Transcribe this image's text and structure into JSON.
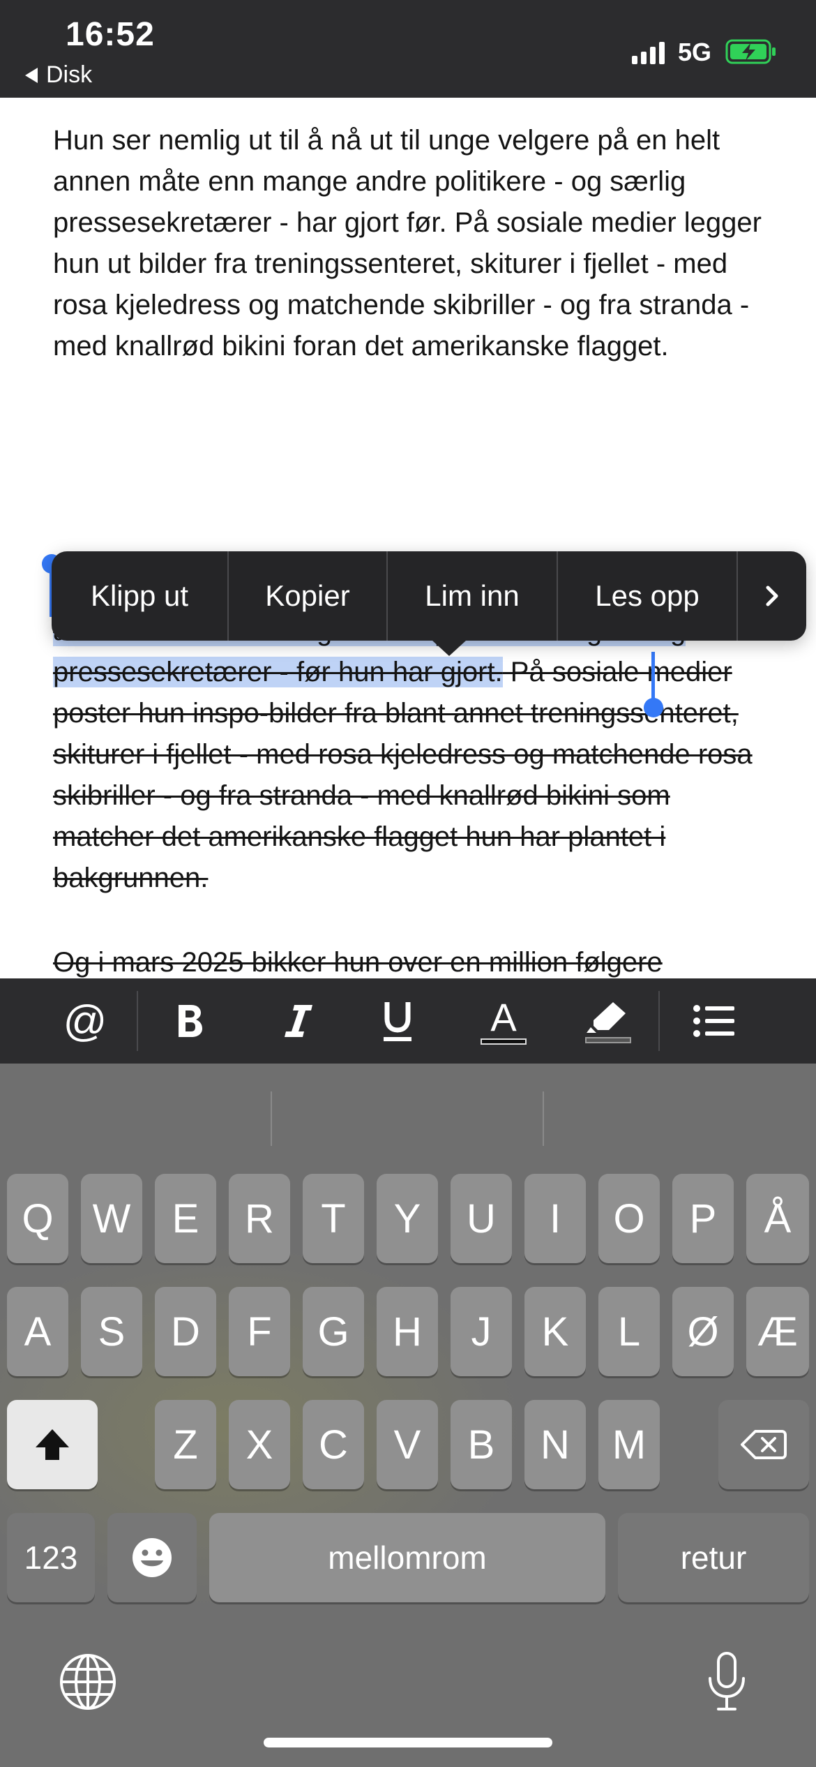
{
  "status_bar": {
    "time": "16:52",
    "back_label": "Disk",
    "network": "5G",
    "battery_state": "charging",
    "battery_color": "#30d158"
  },
  "document": {
    "paragraph_1": "Hun ser nemlig ut til å nå ut til unge velgere på en helt annen måte enn mange andre politikere - og særlig pressesekretærer - har gjort før. På sosiale medier legger hun ut bilder fra treningssenteret, skiturer i fjellet - med rosa kjeledress og matchende skibriller - og fra stranda - med knallrød bikini foran det amerikanske flagget.",
    "paragraph_2_selected": "Hun ser nemlig ut til å nå ut til unge velgere på en helt annen måte enn mange andre politikere - og særlig pressesekretærer - før hun har gjort.",
    "paragraph_2_rest": " På sosiale medier poster hun inspo-bilder fra blant annet treningssenteret, skiturer i fjellet - med rosa kjeledress og matchende rosa skibriller - og fra stranda - med knallrød bikini som matcher det amerikanske flagget hun har plantet i bakgrunnen.",
    "paragraph_3": "Og i mars 2025 bikker hun over en million følgere",
    "selection_color": "#bfd3f6",
    "handle_color": "#3478f6"
  },
  "edit_menu": {
    "items": [
      "Klipp ut",
      "Kopier",
      "Lim inn",
      "Les opp"
    ],
    "more": "›"
  },
  "format_toolbar": {
    "mention": "@",
    "bold_icon": "bold-icon",
    "italic_icon": "italic-icon",
    "underline_icon": "underline-icon",
    "text_color": "A",
    "highlight_icon": "highlighter-icon",
    "list_icon": "bulleted-list-icon"
  },
  "keyboard": {
    "row1": [
      "Q",
      "W",
      "E",
      "R",
      "T",
      "Y",
      "U",
      "I",
      "O",
      "P",
      "Å"
    ],
    "row2": [
      "A",
      "S",
      "D",
      "F",
      "G",
      "H",
      "J",
      "K",
      "L",
      "Ø",
      "Æ"
    ],
    "row3": [
      "Z",
      "X",
      "C",
      "V",
      "B",
      "N",
      "M"
    ],
    "numbers_key": "123",
    "space_key": "mellomrom",
    "return_key": "retur",
    "shift_icon": "shift-icon",
    "delete_icon": "delete-icon",
    "emoji_icon": "emoji-icon",
    "globe_icon": "globe-icon",
    "mic_icon": "microphone-icon"
  }
}
